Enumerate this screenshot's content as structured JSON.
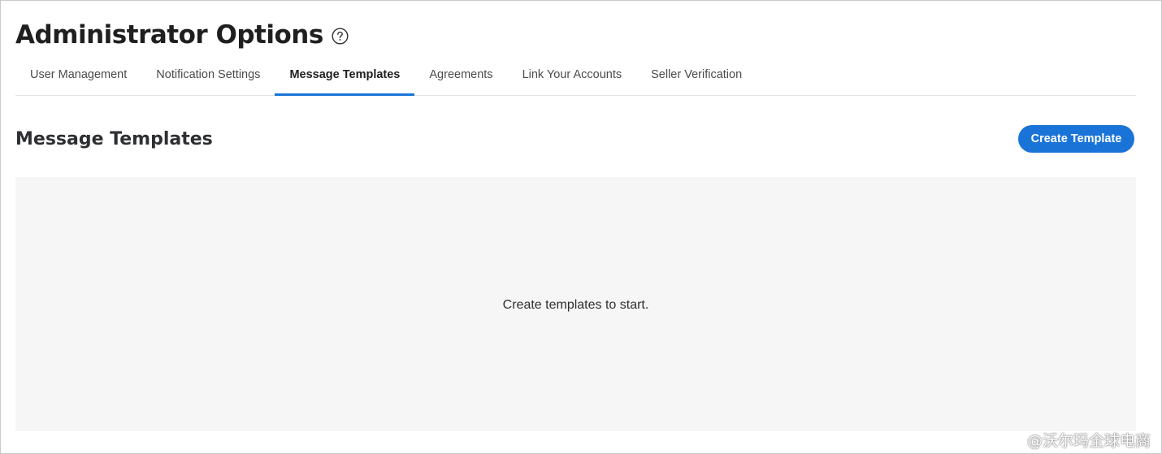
{
  "header": {
    "title": "Administrator Options",
    "help_icon": "help-circle-icon"
  },
  "tabs": [
    {
      "label": "User Management",
      "active": false
    },
    {
      "label": "Notification Settings",
      "active": false
    },
    {
      "label": "Message Templates",
      "active": true
    },
    {
      "label": "Agreements",
      "active": false
    },
    {
      "label": "Link Your Accounts",
      "active": false
    },
    {
      "label": "Seller Verification",
      "active": false
    }
  ],
  "section": {
    "title": "Message Templates",
    "create_button_label": "Create Template"
  },
  "empty_state": {
    "message": "Create templates to start."
  },
  "watermark": {
    "text": "@沃尔玛全球电商"
  },
  "colors": {
    "accent": "#1a74d8",
    "panel_background": "#f6f6f6",
    "divider": "#e3e4e5"
  }
}
